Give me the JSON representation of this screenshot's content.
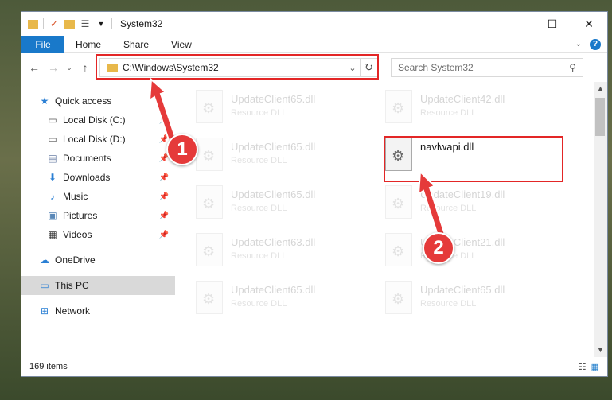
{
  "window": {
    "title": "System32",
    "controls": {
      "minimize": "—",
      "maximize": "☐",
      "close": "✕"
    }
  },
  "ribbon": {
    "tabs": [
      "File",
      "Home",
      "Share",
      "View"
    ]
  },
  "address": {
    "path": "C:\\Windows\\System32"
  },
  "search": {
    "placeholder": "Search System32"
  },
  "sidebar": {
    "items": [
      {
        "label": "Quick access",
        "icon": "star-icon"
      },
      {
        "label": "Local Disk (C:)",
        "icon": "drive-icon"
      },
      {
        "label": "Local Disk (D:)",
        "icon": "drive-icon"
      },
      {
        "label": "Documents",
        "icon": "documents-icon"
      },
      {
        "label": "Downloads",
        "icon": "download-icon"
      },
      {
        "label": "Music",
        "icon": "music-icon"
      },
      {
        "label": "Pictures",
        "icon": "pictures-icon"
      },
      {
        "label": "Videos",
        "icon": "videos-icon"
      },
      {
        "label": "OneDrive",
        "icon": "cloud-icon"
      },
      {
        "label": "This PC",
        "icon": "computer-icon"
      },
      {
        "label": "Network",
        "icon": "network-icon"
      }
    ]
  },
  "files": [
    {
      "name": "UpdateClient65.dll",
      "type": "Resource DLL"
    },
    {
      "name": "UpdateClient42.dll",
      "type": "Resource DLL"
    },
    {
      "name": "UpdateClient65.dll",
      "type": "Resource DLL"
    },
    {
      "name": "navlwapi.dll",
      "type": ""
    },
    {
      "name": "UpdateClient65.dll",
      "type": "Resource DLL"
    },
    {
      "name": "UpdateClient19.dll",
      "type": "Resource DLL"
    },
    {
      "name": "UpdateClient63.dll",
      "type": "Resource DLL"
    },
    {
      "name": "UpdateClient21.dll",
      "type": "Resource DLL"
    },
    {
      "name": "UpdateClient65.dll",
      "type": "Resource DLL"
    },
    {
      "name": "UpdateClient65.dll",
      "type": "Resource DLL"
    }
  ],
  "status": {
    "count": "169 items"
  },
  "annotations": {
    "step1": "1",
    "step2": "2"
  },
  "colors": {
    "accent": "#1979ca",
    "highlight": "#e32626"
  }
}
